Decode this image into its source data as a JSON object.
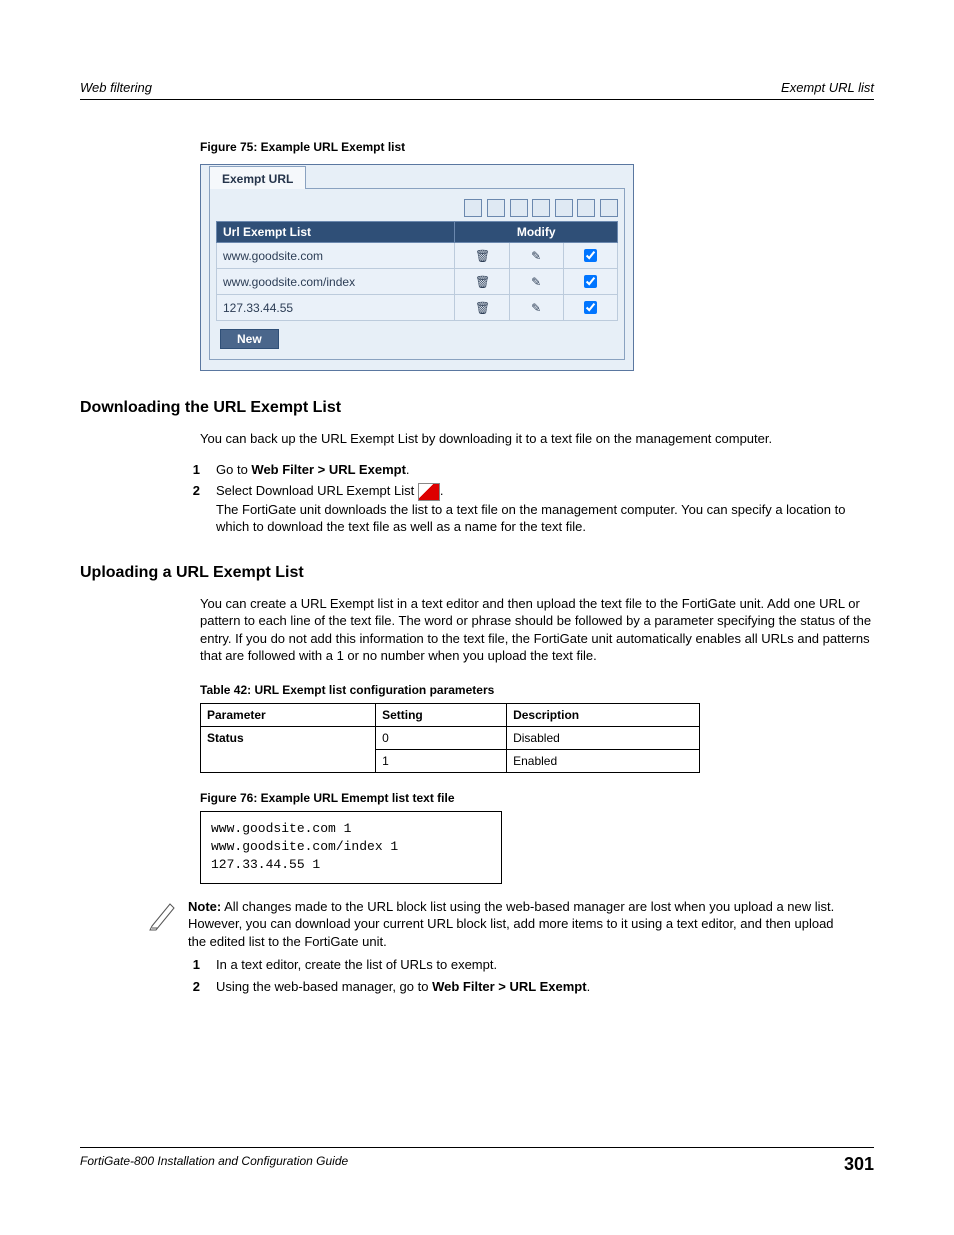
{
  "header": {
    "left": "Web filtering",
    "right": "Exempt URL list"
  },
  "figure75": {
    "caption": "Figure 75: Example URL Exempt list",
    "tab": "Exempt URL",
    "col_url": "Url Exempt List",
    "col_mod": "Modify",
    "rows": [
      "www.goodsite.com",
      "www.goodsite.com/index",
      "127.33.44.55"
    ],
    "new_btn": "New"
  },
  "sec1": {
    "title": "Downloading the URL Exempt List",
    "intro": "You can back up the URL Exempt List by downloading it to a text file on the management computer.",
    "step1_a": "Go to ",
    "step1_b": "Web Filter > URL Exempt",
    "step1_c": ".",
    "step2_a": "Select Download URL Exempt List ",
    "step2_b": ".",
    "step2_note": "The FortiGate unit downloads the list to a text file on the management computer. You can specify a location to which to download the text file as well as a name for the text file."
  },
  "sec2": {
    "title": "Uploading a URL Exempt List",
    "intro": "You can create a URL Exempt list in a text editor and then upload the text file to the FortiGate unit. Add one URL or pattern to each line of the text file. The word or phrase should be followed by a parameter specifying the status of the entry. If you do not add this information to the text file, the FortiGate unit automatically enables all URLs and patterns that are followed with a 1 or no number when you upload the text file."
  },
  "table42": {
    "caption": "Table 42: URL Exempt list configuration parameters",
    "h1": "Parameter",
    "h2": "Setting",
    "h3": "Description",
    "r1c1": "Status",
    "r1c2": "0",
    "r1c3": "Disabled",
    "r2c2": "1",
    "r2c3": "Enabled"
  },
  "figure76": {
    "caption": "Figure 76: Example URL Emempt list text file",
    "l1": "www.goodsite.com 1",
    "l2": "www.goodsite.com/index 1",
    "l3": "127.33.44.55 1"
  },
  "note": {
    "label": "Note:",
    "text": " All changes made to the URL block list using the web-based manager are lost when you upload a new list. However, you can download your current URL block list, add more items to it using a text editor, and then upload the edited list to the FortiGate unit."
  },
  "sec3": {
    "step1": "In a text editor, create the list of URLs to exempt.",
    "step2_a": "Using the web-based manager, go to ",
    "step2_b": "Web Filter > URL Exempt",
    "step2_c": "."
  },
  "footer": {
    "left": "FortiGate-800 Installation and Configuration Guide",
    "right": "301"
  },
  "nums": {
    "n1": "1",
    "n2": "2"
  }
}
